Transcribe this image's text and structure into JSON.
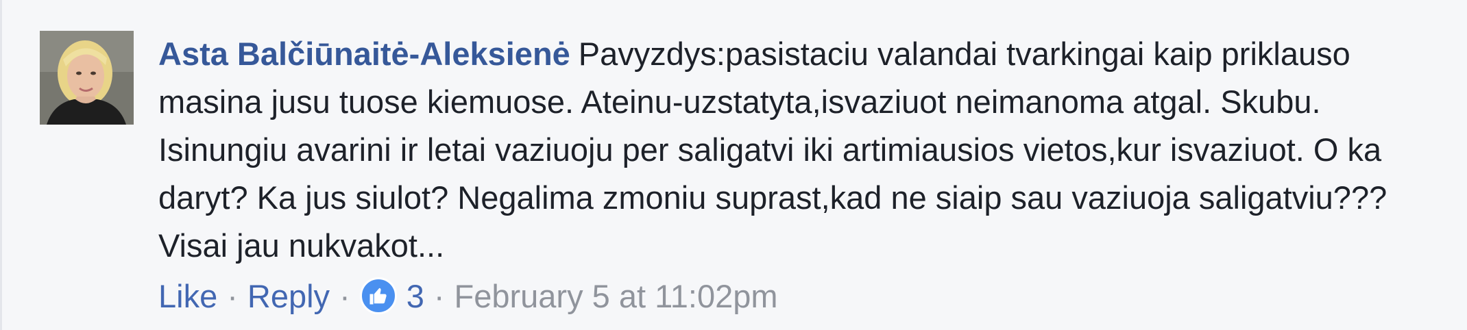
{
  "comment": {
    "author": "Asta Balčiūnaitė-Aleksienė",
    "text": "Pavyzdys:pasistaciu valandai tvarkingai kaip priklauso masina jusu tuose kiemuose. Ateinu-uzstatyta,isvaziuot neimanoma atgal. Skubu. Isinungiu avarini ir letai vaziuoju per saligatvi iki artimiausios vietos,kur isvaziuot. O ka daryt? Ka jus siulot? Negalima zmoniu suprast,kad ne siaip sau vaziuoja saligatviu??? Visai jau nukvakot...",
    "avatar_icon": "user-photo-avatar",
    "actions": {
      "like_label": "Like",
      "reply_label": "Reply",
      "separator": "·",
      "reaction_icon": "thumbs-up-icon",
      "reaction_count": "3",
      "timestamp": "February 5 at 11:02pm"
    }
  },
  "colors": {
    "author": "#365899",
    "link": "#4267b2",
    "muted": "#90949c",
    "text": "#1d2129",
    "background": "#f6f7f9",
    "like_badge": "#4a90f0"
  }
}
